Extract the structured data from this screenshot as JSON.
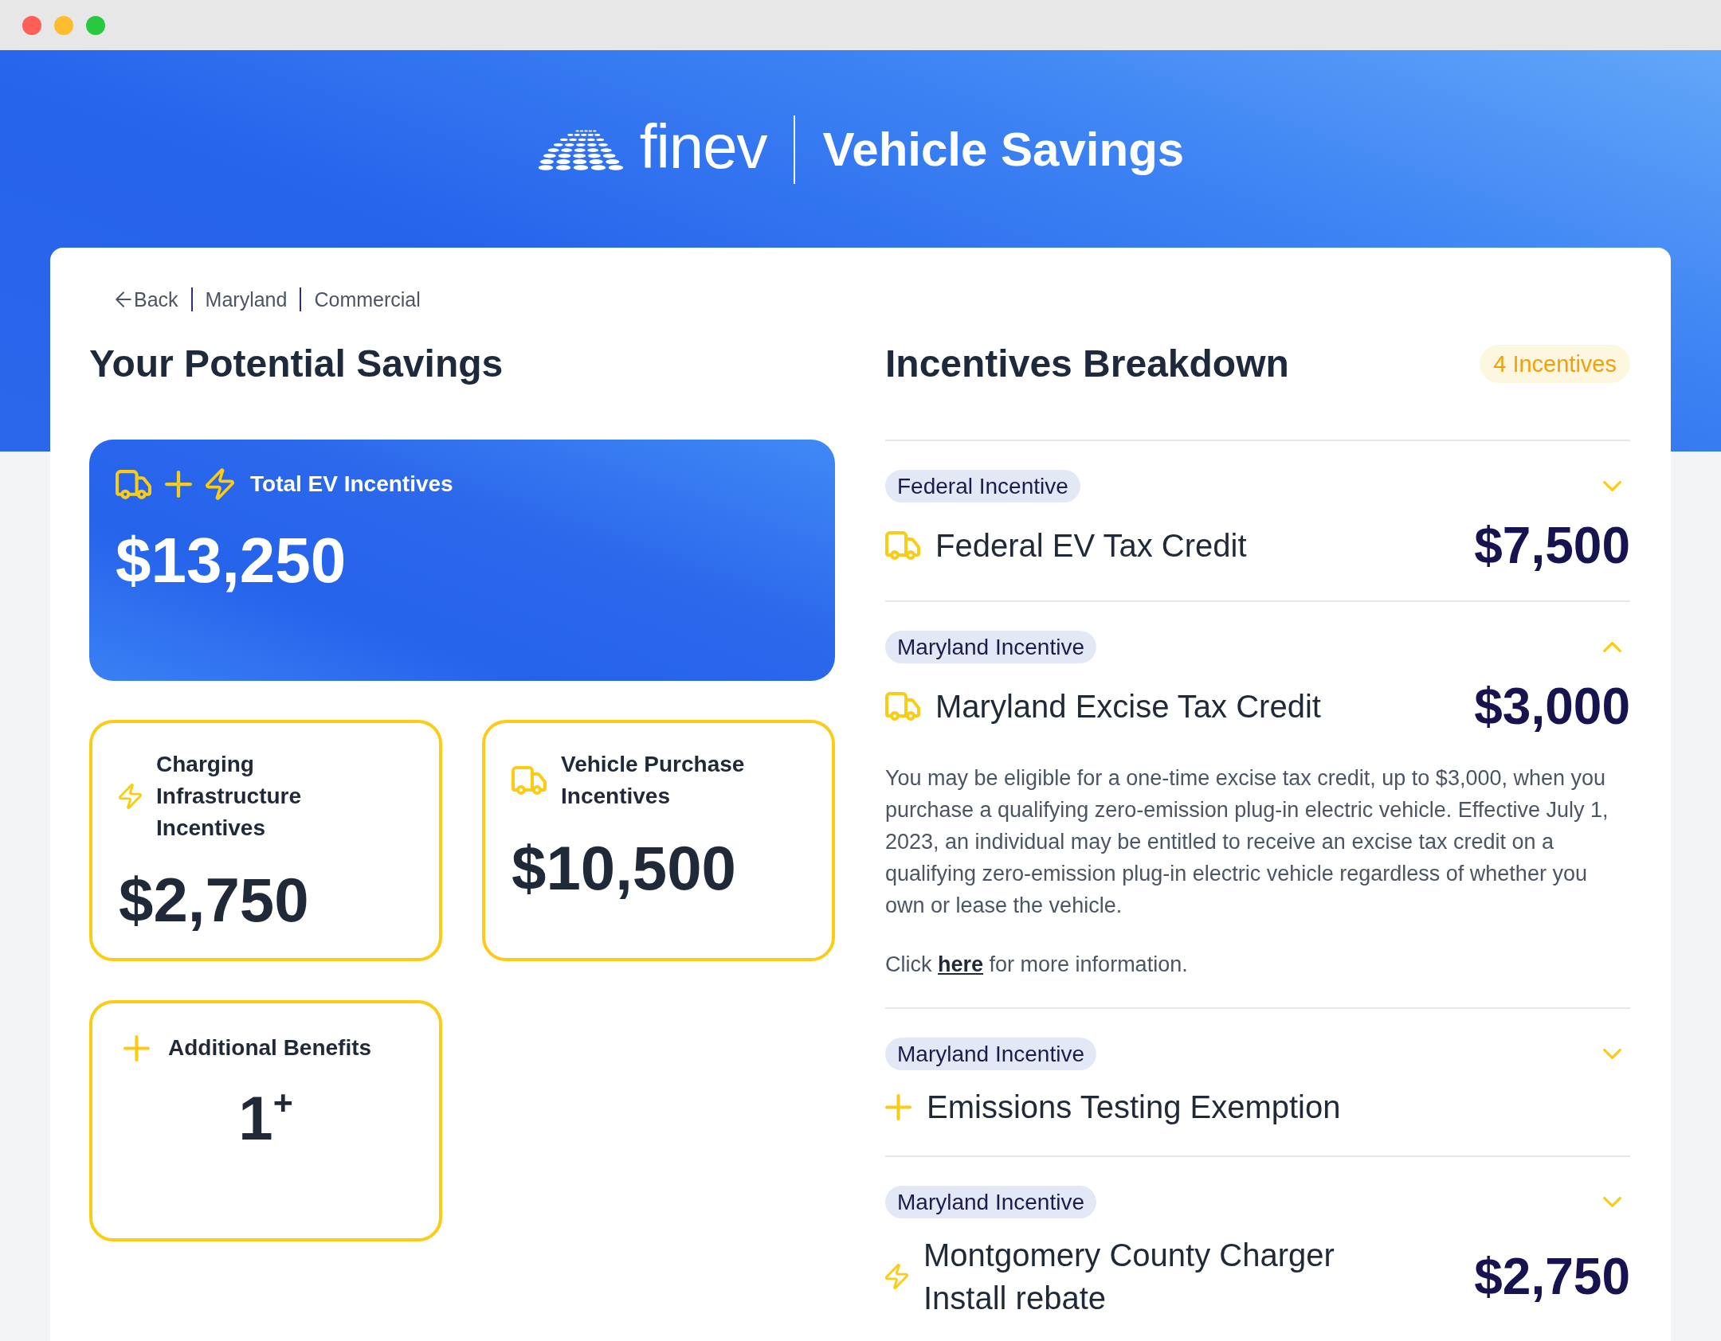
{
  "header": {
    "brand": "finev",
    "title": "Vehicle Savings"
  },
  "breadcrumb": {
    "back": "Back",
    "items": [
      "Maryland",
      "Commercial"
    ]
  },
  "savings": {
    "title": "Your Potential Savings",
    "total": {
      "label": "Total EV Incentives",
      "amount": "$13,250"
    },
    "cards": [
      {
        "kind": "charging",
        "label": "Charging Infrastructure Incentives",
        "value": "$2,750"
      },
      {
        "kind": "vehicle",
        "label": "Vehicle Purchase Incentives",
        "value": "$10,500"
      },
      {
        "kind": "benefit",
        "label": "Additional Benefits",
        "value": "1$^{+}$"
      }
    ]
  },
  "breakdown": {
    "title": "Incentives Breakdown",
    "count": "4 Incentives",
    "items": [
      {
        "tag": "Federal Incentive",
        "kind": "vehicle",
        "title": "Federal EV Tax Credit",
        "amount": "$7,500",
        "expanded": false
      },
      {
        "tag": "Maryland Incentive",
        "kind": "vehicle",
        "title": "Maryland Excise Tax Credit",
        "amount": "$3,000",
        "expanded": true,
        "description": "You may be eligible for a one-time excise tax credit, up to $3,000, when you purchase a qualifying zero-emission plug-in electric vehicle. Effective July 1, 2023, an individual may be entitled to receive an excise tax credit on a qualifying zero-emission plug-in electric vehicle regardless of whether you own or lease the vehicle.",
        "more_info": {
          "before": "Click",
          "link": "here",
          "after": "for more information."
        }
      },
      {
        "tag": "Maryland Incentive",
        "kind": "benefit",
        "title": "Emissions Testing Exemption",
        "expanded": false
      },
      {
        "tag": "Maryland Incentive",
        "kind": "charging",
        "title": "Montgomery County Charger Install rebate",
        "amount": "$2,750",
        "expanded": false
      }
    ]
  }
}
